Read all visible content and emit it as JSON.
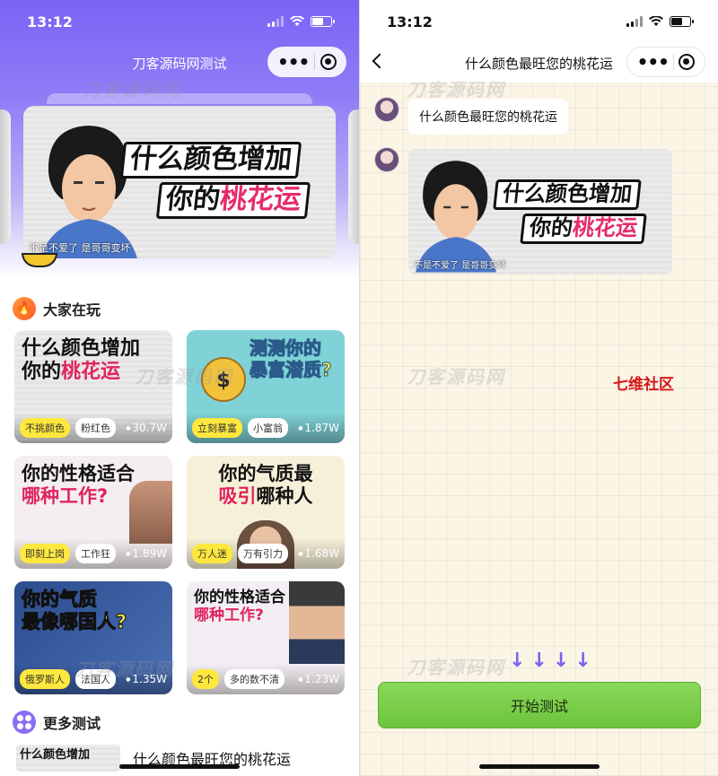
{
  "left": {
    "status_time": "13:12",
    "nav_title": "刀客源码网测试",
    "banner": {
      "line1": "什么颜色增加",
      "line2_prefix": "你的",
      "line2_highlight": "桃花运",
      "caption": "不是不爱了 是哥哥变坏"
    },
    "section_popular": "大家在玩",
    "cards": [
      {
        "t1": "什么颜色增加",
        "t2a": "你的",
        "t2b": "桃花运",
        "tag1": "不挑颜色",
        "tag2": "粉红色",
        "views": "30.7W"
      },
      {
        "t1": "测测你的",
        "t2a": "",
        "t2b": "暴富潜质?",
        "tag1": "立刻暴富",
        "tag2": "小富翁",
        "views": "1.87W"
      },
      {
        "t1": "你的性格适合",
        "t2a": "",
        "t2b": "哪种工作?",
        "tag1": "即刻上岗",
        "tag2": "工作狂",
        "views": "1.89W"
      },
      {
        "t1": "你的气质最",
        "t2a": "吸引",
        "t2b": "哪种人",
        "tag1": "万人迷",
        "tag2": "万有引力",
        "views": "1.68W"
      },
      {
        "t1": "你的气质",
        "t2a": "最像",
        "t2b": "哪国人?",
        "tag1": "俄罗斯人",
        "tag2": "法国人",
        "views": "1.35W"
      },
      {
        "t1": "你的性格适合",
        "t2a": "",
        "t2b": "哪种工作?",
        "tag1": "2个",
        "tag2": "多的数不清",
        "views": "1.23W"
      }
    ],
    "section_more": "更多测试",
    "more_item": {
      "thumb": "什么颜色增加",
      "name": "什么颜色最旺您的桃花运"
    },
    "watermark": "刀客源码网"
  },
  "right": {
    "status_time": "13:12",
    "nav_title": "什么颜色最旺您的桃花运",
    "chat_bubble": "什么颜色最旺您的桃花运",
    "community_text": "七维社区",
    "start_button": "开始测试",
    "watermark": "刀客源码网"
  },
  "colors": {
    "accent_purple": "#7b63f5",
    "highlight_pink": "#e52b6b",
    "start_green": "#7ccf4b",
    "community_red": "#d51818"
  }
}
